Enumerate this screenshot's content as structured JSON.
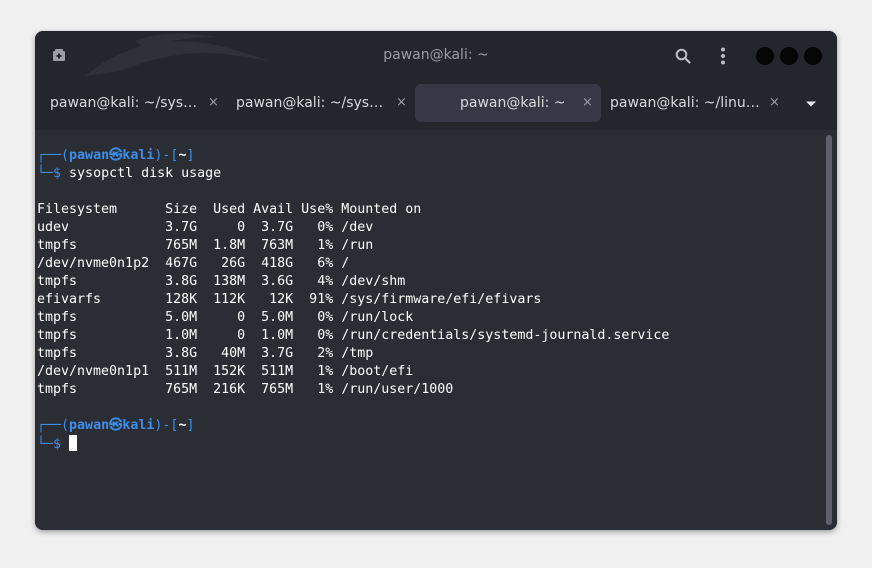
{
  "window": {
    "title": "pawan@kali: ~",
    "icons": {
      "new_tab": "new-tab-icon",
      "search": "search-icon",
      "menu": "kebab-menu-icon"
    }
  },
  "tabs": [
    {
      "label": "pawan@kali: ~/sys…",
      "close": "×",
      "active": false
    },
    {
      "label": "pawan@kali: ~/sys…",
      "close": "×",
      "active": false
    },
    {
      "label": "pawan@kali: ~",
      "close": "×",
      "active": true
    },
    {
      "label": "pawan@kali: ~/linu…",
      "close": "×",
      "active": false
    }
  ],
  "terminal": {
    "prompt": {
      "corner_top": "┌──",
      "open": "(",
      "user": "pawan㉿kali",
      "close": ")-[",
      "path": "~",
      "end": "]",
      "corner_bottom": "└─",
      "symbol": "$"
    },
    "command": "sysopctl disk usage",
    "table": [
      "Filesystem      Size  Used Avail Use% Mounted on",
      "udev            3.7G     0  3.7G   0% /dev",
      "tmpfs           765M  1.8M  763M   1% /run",
      "/dev/nvme0n1p2  467G   26G  418G   6% /",
      "tmpfs           3.8G  138M  3.6G   4% /dev/shm",
      "efivarfs        128K  112K   12K  91% /sys/firmware/efi/efivars",
      "tmpfs           5.0M     0  5.0M   0% /run/lock",
      "tmpfs           1.0M     0  1.0M   0% /run/credentials/systemd-journald.service",
      "tmpfs           3.8G   40M  3.7G   2% /tmp",
      "/dev/nvme0n1p1  511M  152K  511M   1% /boot/efi",
      "tmpfs           765M  216K  765M   1% /run/user/1000"
    ]
  },
  "colors": {
    "prompt_accent": "#3c8ee8",
    "terminal_bg": "#2b2d35",
    "titlebar_bg": "#24262d"
  }
}
